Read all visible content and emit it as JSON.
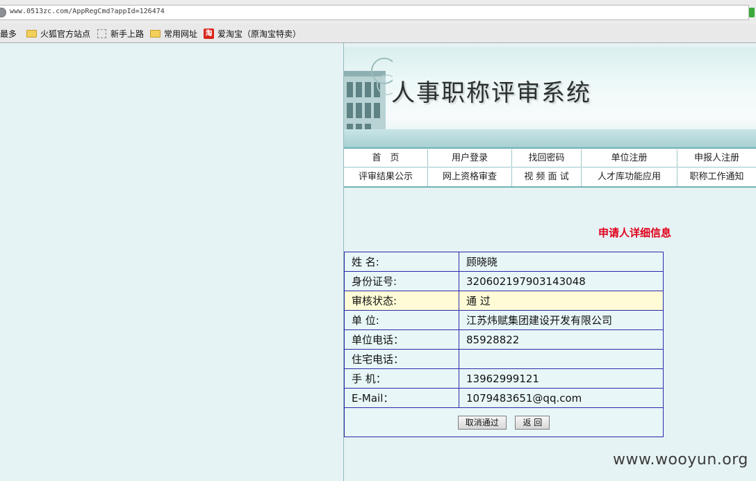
{
  "browser": {
    "url": "www.0513zc.com/AppRegCmd?appId=126474",
    "bookmarks": [
      "访问最多",
      "火狐官方站点",
      "新手上路",
      "常用网址",
      "爱淘宝（原淘宝特卖）"
    ]
  },
  "banner": {
    "title": "人事职称评审系统"
  },
  "nav": {
    "row1": [
      "首　页",
      "用户登录",
      "找回密码",
      "单位注册",
      "申报人注册"
    ],
    "row2": [
      "评审结果公示",
      "网上资格审查",
      "视 频 面 试",
      "人才库功能应用",
      "职称工作通知"
    ]
  },
  "detail": {
    "heading": "申请人详细信息",
    "rows": [
      {
        "label": "姓 名:",
        "value": "顾晓晓"
      },
      {
        "label": "身份证号:",
        "value": "320602197903143048"
      },
      {
        "label": "审核状态:",
        "value": "通 过"
      },
      {
        "label": "单 位:",
        "value": "江苏炜赋集团建设开发有限公司"
      },
      {
        "label": "单位电话：",
        "value": "85928822"
      },
      {
        "label": "住宅电话：",
        "value": ""
      },
      {
        "label": "手 机：",
        "value": "13962999121"
      },
      {
        "label": "E-Mail：",
        "value": "1079483651@qq.com"
      }
    ],
    "buttons": {
      "cancel_pass": "取消通过",
      "back": "返 回"
    }
  },
  "watermark": "www.wooyun.org",
  "colors": {
    "heading": "#e0001a",
    "table_border": "#2a2aa8",
    "highlight_row": "#fffbd6",
    "page_bg": "#e6f3f4"
  }
}
